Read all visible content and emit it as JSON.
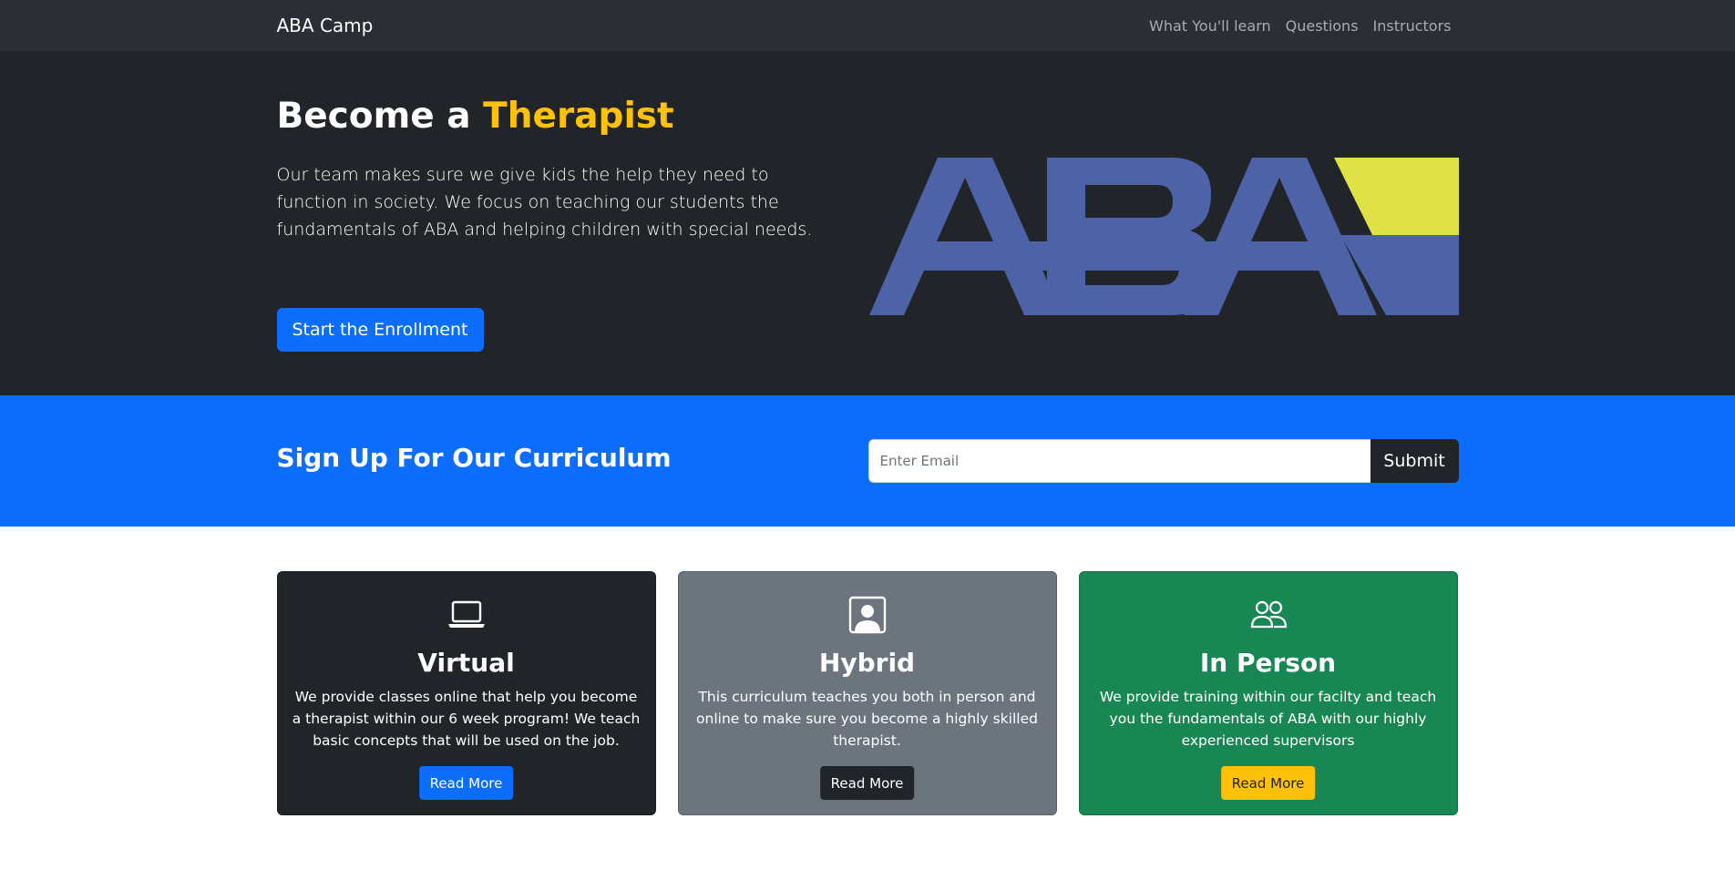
{
  "navbar": {
    "brand": "ABA Camp",
    "links": [
      "What You'll learn",
      "Questions",
      "Instructors"
    ],
    "background": "#2b2f35"
  },
  "hero": {
    "title_part1": "Become a ",
    "title_accent": "Therapist",
    "lead": "Our team makes sure we give kids the help they need to function in society. We focus on teaching our students the fundamentals of ABA and helping children with special needs.",
    "cta_label": "Start the Enrollment",
    "logo_text": "ABA",
    "accent_color": "#ffc107",
    "background": "#212529"
  },
  "signup": {
    "title": "Sign Up For Our Curriculum",
    "email_placeholder": "Enter Email",
    "submit_label": "Submit",
    "background": "#0d6efd"
  },
  "cards": [
    {
      "icon": "laptop-icon",
      "title": "Virtual",
      "text": "We provide classes online that help you become a therapist within our 6 week program! We teach basic concepts that will be used on the job.",
      "button_label": "Read More",
      "background": "#212529"
    },
    {
      "icon": "person-square-icon",
      "title": "Hybrid",
      "text": "This curriculum teaches you both in person and online to make sure you become a highly skilled therapist.",
      "button_label": "Read More",
      "background": "#6c757d"
    },
    {
      "icon": "people-icon",
      "title": "In Person",
      "text": "We provide training within our facilty and teach you the fundamentals of ABA with our highly experienced supervisors",
      "button_label": "Read More",
      "background": "#198754"
    }
  ]
}
